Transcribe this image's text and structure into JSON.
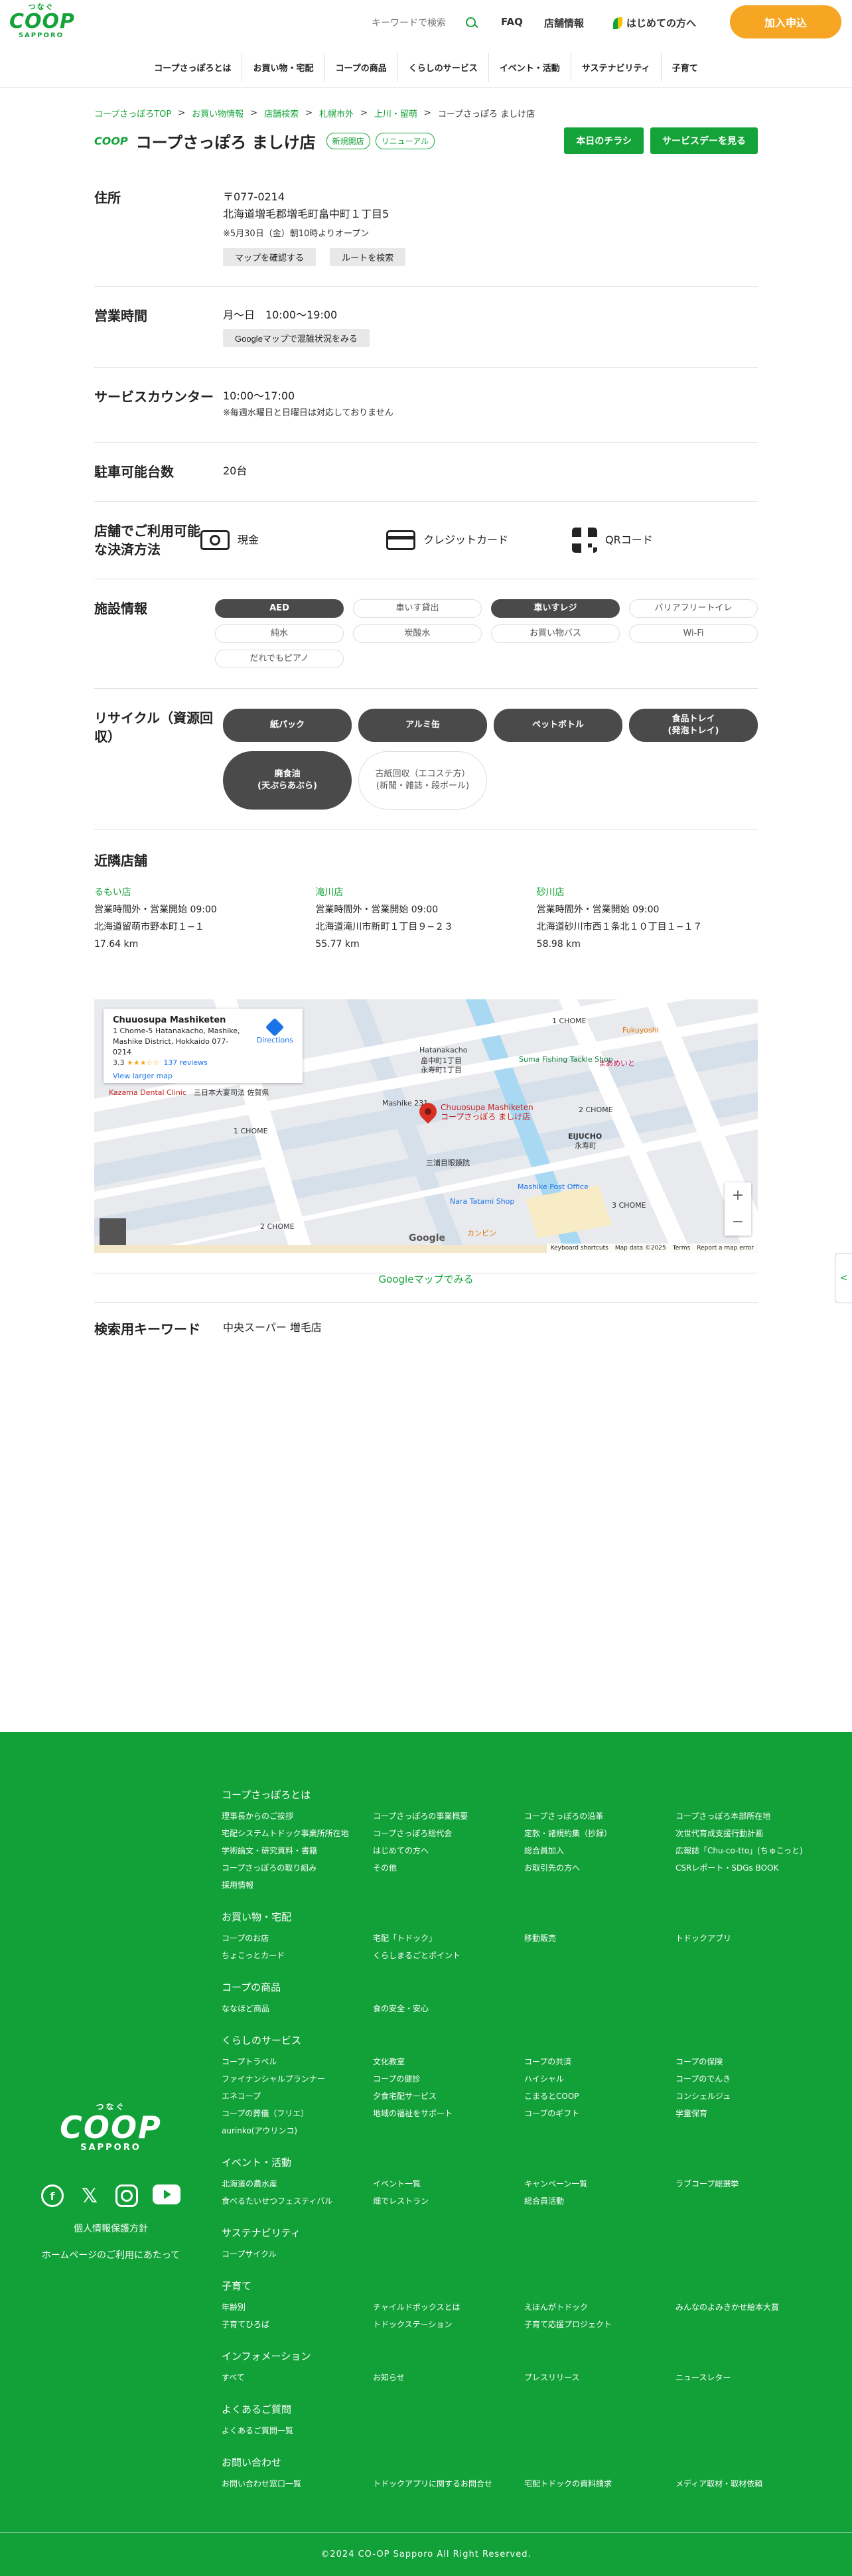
{
  "header": {
    "logo": {
      "tsunagu": "つなぐ",
      "coop": "COOP",
      "sapporo": "SAPPORO"
    },
    "search_placeholder": "キーワードで検索",
    "faq": "FAQ",
    "store_info": "店舗情報",
    "first_time": "はじめての方へ",
    "join": "加入申込",
    "nav": [
      "コープさっぽろとは",
      "お買い物・宅配",
      "コープの商品",
      "くらしのサービス",
      "イベント・活動",
      "サステナビリティ",
      "子育て"
    ]
  },
  "breadcrumb": [
    "コープさっぽろTOP",
    "お買い物情報",
    "店舗検索",
    "札幌市外",
    "上川・留萌",
    "コープさっぽろ ましけ店"
  ],
  "store": {
    "logo": "COOP",
    "name": "コープさっぽろ ましけ店",
    "tags": [
      "新規開店",
      "リニューアル"
    ],
    "flyer_button": "本日のチラシ",
    "service_day_button": "サービスデーを見る"
  },
  "address": {
    "label": "住所",
    "postal": "〒077-0214",
    "line": "北海道増毛郡増毛町畠中町１丁目5",
    "note": "※5月30日（金）朝10時よりオープン",
    "map_btn": "マップを確認する",
    "route_btn": "ルートを検索"
  },
  "hours": {
    "label": "営業時間",
    "value": "月〜日　10:00〜19:00",
    "btn": "Googleマップで混雑状況をみる"
  },
  "service_counter": {
    "label": "サービスカウンター",
    "value": "10:00〜17:00",
    "note": "※毎週水曜日と日曜日は対応しておりません"
  },
  "parking": {
    "label": "駐車可能台数",
    "value": "20台"
  },
  "payment": {
    "label": "店舗でご利用可能な決済方法",
    "items": [
      {
        "icon": "cash-icon",
        "label": "現金"
      },
      {
        "icon": "credit-card-icon",
        "label": "クレジットカード"
      },
      {
        "icon": "qr-code-icon",
        "label": "QRコード"
      }
    ]
  },
  "facilities": {
    "label": "施設情報",
    "items": [
      {
        "label": "AED",
        "active": true
      },
      {
        "label": "車いす貸出",
        "active": false
      },
      {
        "label": "車いすレジ",
        "active": true
      },
      {
        "label": "バリアフリートイレ",
        "active": false
      },
      {
        "label": "純水",
        "active": false
      },
      {
        "label": "炭酸水",
        "active": false
      },
      {
        "label": "お買い物バス",
        "active": false
      },
      {
        "label": "Wi-Fi",
        "active": false
      },
      {
        "label": "だれでもピアノ",
        "active": false
      }
    ]
  },
  "recycle": {
    "label": "リサイクル（資源回収）",
    "items": [
      {
        "label": "紙パック",
        "active": true
      },
      {
        "label": "アルミ缶",
        "active": true
      },
      {
        "label": "ペットボトル",
        "active": true
      },
      {
        "label": "食品トレイ\n(発泡トレイ)",
        "active": true
      },
      {
        "label": "廃食油\n(天ぷらあぶら)",
        "active": true
      },
      {
        "label": "古紙回収（エコステ方）\n(新聞・雑誌・段ボール)",
        "active": false
      }
    ]
  },
  "nearby": {
    "title": "近隣店舗",
    "stores": [
      {
        "name": "るもい店",
        "hours": "営業時間外・営業開始 09:00",
        "address": "北海道留萌市野本町１−１",
        "distance": "17.64 km"
      },
      {
        "name": "滝川店",
        "hours": "営業時間外・営業開始 09:00",
        "address": "北海道滝川市新町１丁目９−２３",
        "distance": "55.77 km"
      },
      {
        "name": "砂川店",
        "hours": "営業時間外・営業開始 09:00",
        "address": "北海道砂川市西１条北１０丁目１−１７",
        "distance": "58.98 km"
      }
    ]
  },
  "map": {
    "card_title": "Chuuosupa Mashiketen",
    "card_address": "1 Chome-5 Hatanakacho, Mashike, Mashike District, Hokkaido 077-0214",
    "rating": "3.3",
    "stars": "★★★☆☆",
    "reviews": "137 reviews",
    "larger": "View larger map",
    "directions": "Directions",
    "pin_name": "Chuuosupa Mashiketen",
    "pin_sub": "コープさっぽろ ましけ店",
    "labels": [
      "Kazama Dental Clinic",
      "三日本大宴司法 佐賀県",
      "1 CHOME",
      "Hatanakacho",
      "畠中町1丁目",
      "永寿町1丁目",
      "Suma Fishing Tackle Shop",
      "Fukuyoshi",
      "まあめいと",
      "2 CHOME",
      "EIJUCHO",
      "永寿町",
      "Mashike Post Office",
      "三浦目眼鏡院",
      "Nara Tatami Shop",
      "2 CHOME",
      "3 CHOME",
      "Google",
      "カンピン",
      "1 CHOME",
      "Mashike 231"
    ],
    "footer": [
      "Keyboard shortcuts",
      "Map data ©2025",
      "Terms",
      "Report a map error"
    ],
    "zoom_in": "+",
    "zoom_out": "−",
    "google": "Google"
  },
  "google_map_link": "Googleマップでみる",
  "keywords": {
    "label": "検索用キーワード",
    "value": "中央スーパー 増毛店"
  },
  "side_tab": "<",
  "footer": {
    "logo": {
      "tsunagu": "つなぐ",
      "coop": "COOP",
      "sapporo": "SAPPORO"
    },
    "sns": [
      "facebook-icon",
      "x-icon",
      "instagram-icon",
      "youtube-icon"
    ],
    "privacy": "個人情報保護方針",
    "terms": "ホームページのご利用にあたって",
    "sections": [
      {
        "title": "コープさっぽろとは",
        "links": [
          "理事長からのご挨拶",
          "コープさっぽろの事業概要",
          "コープさっぽろの沿革",
          "コープさっぽろ本部所在地",
          "宅配システムトドック事業所所在地",
          "コープさっぽろ総代会",
          "定款・諸規約集（抄録）",
          "次世代育成支援行動計画",
          "学術論文・研究資料・書籍",
          "はじめての方へ",
          "総合員加入",
          "広報誌「Chu-co-tto」(ちゅこっと)",
          "コープさっぽろの取り組み",
          "その他",
          "お取引先の方へ",
          "CSRレポート・SDGs BOOK",
          "採用情報"
        ]
      },
      {
        "title": "お買い物・宅配",
        "links": [
          "コープのお店",
          "宅配「トドック」",
          "移動販売",
          "トドックアプリ",
          "ちょこっとカード",
          "くらしまるごとポイント"
        ]
      },
      {
        "title": "コープの商品",
        "links": [
          "ななほど商品",
          "食の安全・安心"
        ]
      },
      {
        "title": "くらしのサービス",
        "links": [
          "コープトラベル",
          "文化教室",
          "コープの共済",
          "コープの保険",
          "ファイナンシャルプランナー",
          "コープの健診",
          "ハイシャル",
          "コープのでんき",
          "エネコープ",
          "夕食宅配サービス",
          "こまるとCOOP",
          "コンシェルジュ",
          "コープの葬儀（フリエ）",
          "地域の福祉をサポート",
          "コープのギフト",
          "学童保育",
          "aurinko(アウリンコ)"
        ]
      },
      {
        "title": "イベント・活動",
        "links": [
          "北海道の農水産",
          "イベント一覧",
          "キャンペーン一覧",
          "ラブコープ総選挙",
          "食べるたいせつフェスティバル",
          "畑でレストラン",
          "総合員活動"
        ]
      },
      {
        "title": "サステナビリティ",
        "links": [
          "コープサイクル"
        ]
      },
      {
        "title": "子育て",
        "links": [
          "年齢別",
          "チャイルドボックスとは",
          "えほんがトドック",
          "みんなのよみきかせ絵本大賞",
          "子育てひろば",
          "トドックステーション",
          "子育て応援プロジェクト"
        ]
      },
      {
        "title": "インフォメーション",
        "links": [
          "すべて",
          "お知らせ",
          "プレスリリース",
          "ニュースレター"
        ]
      },
      {
        "title": "よくあるご質問",
        "links": [
          "よくあるご質問一覧"
        ]
      },
      {
        "title": "お問い合わせ",
        "links": [
          "お問い合わせ窓口一覧",
          "トドックアプリに関するお問合せ",
          "宅配トドックの資料請求",
          "メディア取材・取材依頼"
        ]
      }
    ],
    "copyright": "©2024 CO-OP Sapporo All Right Reserved."
  }
}
